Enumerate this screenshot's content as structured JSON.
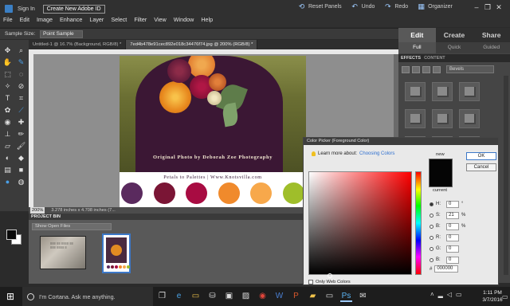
{
  "topbar": {
    "sign_in": "Sign In",
    "create_id": "Create New Adobe ID",
    "reset_panels": "Reset Panels",
    "undo": "Undo",
    "redo": "Redo",
    "organizer": "Organizer"
  },
  "menu": [
    "File",
    "Edit",
    "Image",
    "Enhance",
    "Layer",
    "Select",
    "Filter",
    "View",
    "Window",
    "Help"
  ],
  "tool_options": {
    "label": "Sample Size:",
    "value": "Point Sample"
  },
  "doc_tabs": [
    {
      "label": "Untitled-1 @ 16.7% (Background, RGB/8) *"
    },
    {
      "label": "7ed4b478e91cec892e018c34476f74.jpg @ 200% (RGB/8) *"
    }
  ],
  "right_panel": {
    "modes": [
      "Edit",
      "Create",
      "Share"
    ],
    "sub_modes": [
      "Full",
      "Quick",
      "Guided"
    ],
    "fx_tabs": [
      "EFFECTS",
      "CONTENT"
    ],
    "effect_select": "Bevels"
  },
  "photo": {
    "caption": "Original Photo by Deborah Zoe Photography",
    "palette_title": "Petals to Palettes | Www.Knotsvilla.com",
    "swatches": [
      "#5a2a5e",
      "#7a1535",
      "#a80c42",
      "#f08a2c",
      "#f7a84b",
      "#9fbe2a"
    ]
  },
  "status": {
    "zoom": "200%",
    "info": "3.278 inches x 4.708 inches (7..."
  },
  "project_bin": {
    "title": "PROJECT BIN",
    "filter": "Show Open Files"
  },
  "color_picker": {
    "title": "Color Picker (Foreground Color)",
    "learn_prefix": "Learn more about:",
    "learn_link": "Choosing Colors",
    "new_label": "new",
    "current_label": "current",
    "ok": "OK",
    "cancel": "Cancel",
    "fields": [
      {
        "label": "H:",
        "value": "0",
        "unit": "°",
        "selected": true
      },
      {
        "label": "S:",
        "value": "21",
        "unit": "%",
        "selected": false
      },
      {
        "label": "B:",
        "value": "0",
        "unit": "%",
        "selected": false
      },
      {
        "label": "R:",
        "value": "0",
        "unit": "",
        "selected": false
      },
      {
        "label": "G:",
        "value": "0",
        "unit": "",
        "selected": false
      },
      {
        "label": "B:",
        "value": "0",
        "unit": "",
        "selected": false
      }
    ],
    "hex_prefix": "#",
    "hex": "000000",
    "web_only": "Only Web Colors"
  },
  "taskbar": {
    "search_placeholder": "I'm Cortana. Ask me anything.",
    "time": "1:11 PM",
    "date": "3/7/2016"
  },
  "colors": {
    "accent": "#3c78c8",
    "fg": "#000000",
    "bg": "#ffffff"
  }
}
